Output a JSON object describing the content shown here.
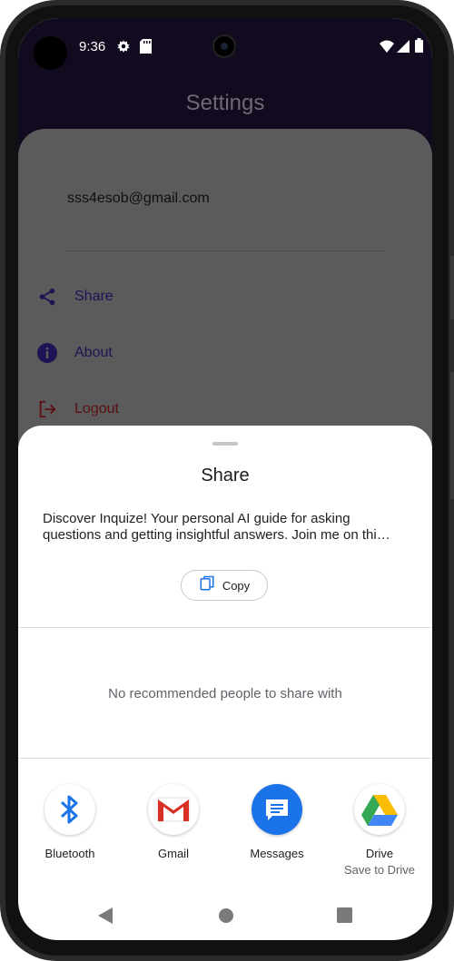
{
  "status_bar": {
    "time": "9:36"
  },
  "app": {
    "title": "Settings",
    "email": "sss4esob@gmail.com",
    "menu": [
      {
        "label": "Share",
        "icon": "share-icon"
      },
      {
        "label": "About",
        "icon": "info-icon"
      },
      {
        "label": "Logout",
        "icon": "logout-icon"
      }
    ]
  },
  "share_sheet": {
    "title": "Share",
    "text": "Discover Inquize! Your personal AI guide for asking questions and getting insightful answers. Join me on thi…",
    "copy_label": "Copy",
    "no_recommendations": "No recommended people to share with",
    "apps": [
      {
        "name": "Bluetooth",
        "icon": "bluetooth-icon"
      },
      {
        "name": "Gmail",
        "icon": "gmail-icon"
      },
      {
        "name": "Messages",
        "icon": "messages-icon"
      },
      {
        "name": "Drive",
        "subtitle": "Save to Drive",
        "icon": "drive-icon"
      }
    ]
  },
  "colors": {
    "accent": "#1a73e8",
    "app_bar": "#120a1e",
    "menu_text": "#1e1453",
    "logout": "#5a1010"
  }
}
